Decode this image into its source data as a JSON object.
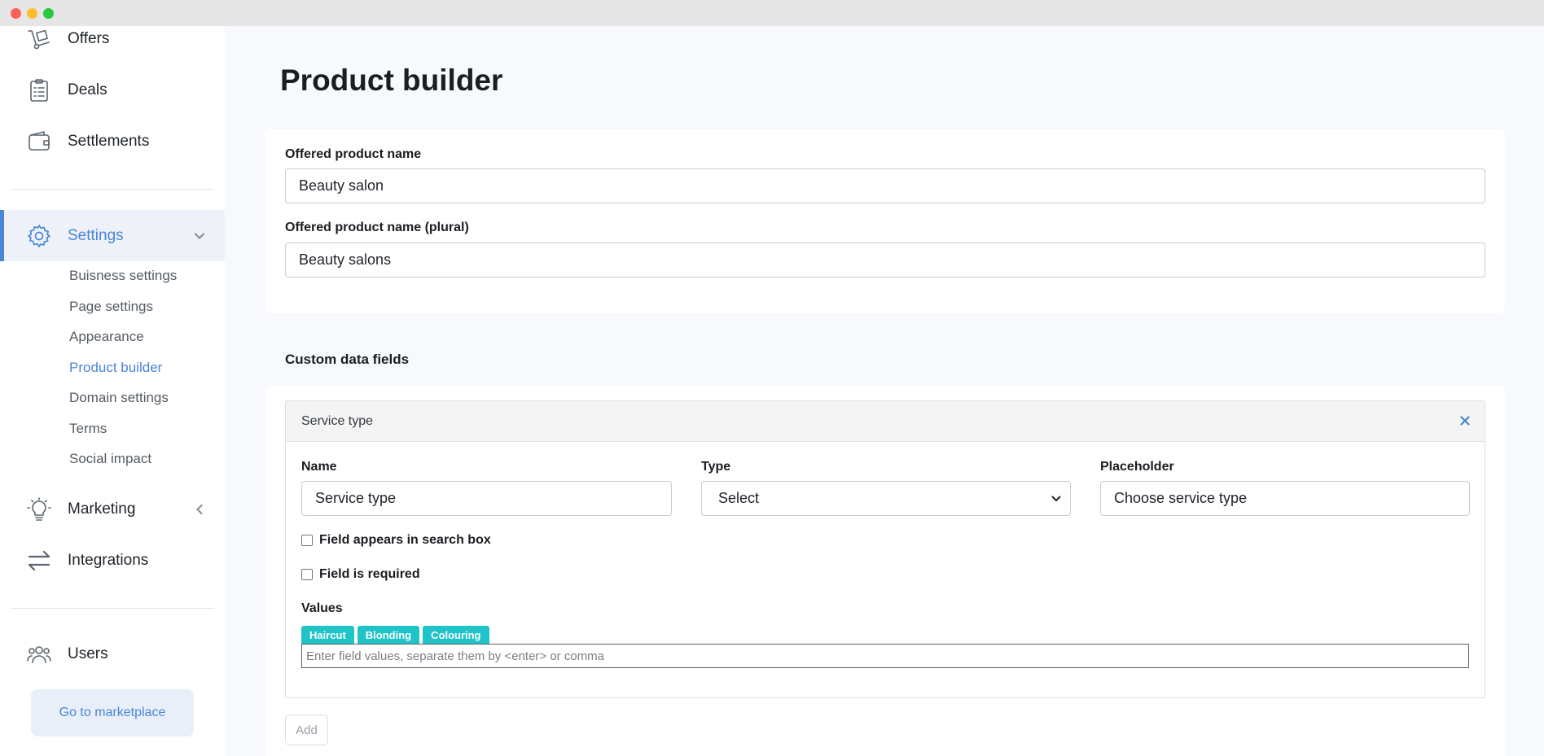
{
  "window": {
    "controls": [
      "close",
      "minimize",
      "maximize"
    ]
  },
  "sidebar": {
    "items": [
      {
        "label": "Offers",
        "icon": "hand-truck-icon"
      },
      {
        "label": "Deals",
        "icon": "clipboard-icon"
      },
      {
        "label": "Settlements",
        "icon": "wallet-icon"
      }
    ],
    "settings": {
      "label": "Settings",
      "icon": "gear-icon",
      "expanded": true,
      "subitems": [
        "Buisness settings",
        "Page settings",
        "Appearance",
        "Product builder",
        "Domain settings",
        "Terms",
        "Social impact"
      ],
      "current": "Product builder"
    },
    "marketing": {
      "label": "Marketing",
      "icon": "lightbulb-icon"
    },
    "integrations": {
      "label": "Integrations",
      "icon": "arrows-swap-icon"
    },
    "users": {
      "label": "Users",
      "icon": "users-icon"
    },
    "marketplace_button": "Go to marketplace"
  },
  "main": {
    "title": "Product builder",
    "product_name": {
      "label": "Offered product name",
      "value": "Beauty salon"
    },
    "product_name_plural": {
      "label": "Offered product name (plural)",
      "value": "Beauty salons"
    },
    "custom_fields": {
      "title": "Custom data fields",
      "field": {
        "header": "Service type",
        "name_label": "Name",
        "name_value": "Service type",
        "type_label": "Type",
        "type_value": "Select",
        "placeholder_label": "Placeholder",
        "placeholder_value": "Choose service type",
        "in_search_label": "Field appears in search box",
        "required_label": "Field is required",
        "values_label": "Values",
        "values": [
          "Haircut",
          "Blonding",
          "Colouring"
        ],
        "values_placeholder": "Enter field values, separate them by <enter> or comma"
      },
      "add_label": "Add"
    }
  },
  "colors": {
    "accent": "#4a86d6",
    "tag": "#1fc4c9"
  }
}
